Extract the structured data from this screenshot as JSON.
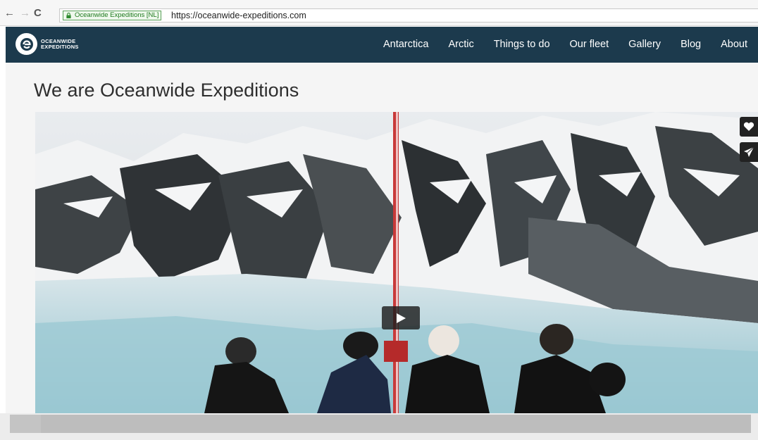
{
  "browser": {
    "back_icon": "←",
    "forward_icon": "→",
    "reload_icon": "C",
    "ev_badge": "Oceanwide Expeditions [NL]",
    "url": "https://oceanwide-expeditions.com"
  },
  "site": {
    "logo_line1": "OCEANWIDE",
    "logo_line2": "EXPEDITIONS",
    "menu": [
      "Antarctica",
      "Arctic",
      "Things to do",
      "Our fleet",
      "Gallery",
      "Blog",
      "About"
    ]
  },
  "main": {
    "title": "We are Oceanwide Expeditions"
  },
  "colors": {
    "nav_background": "#1c3a4d",
    "ev_green": "#1f7a1f"
  },
  "icons": {
    "play": "play-icon",
    "heart": "heart-icon",
    "send": "send-icon",
    "lock": "lock-icon"
  }
}
